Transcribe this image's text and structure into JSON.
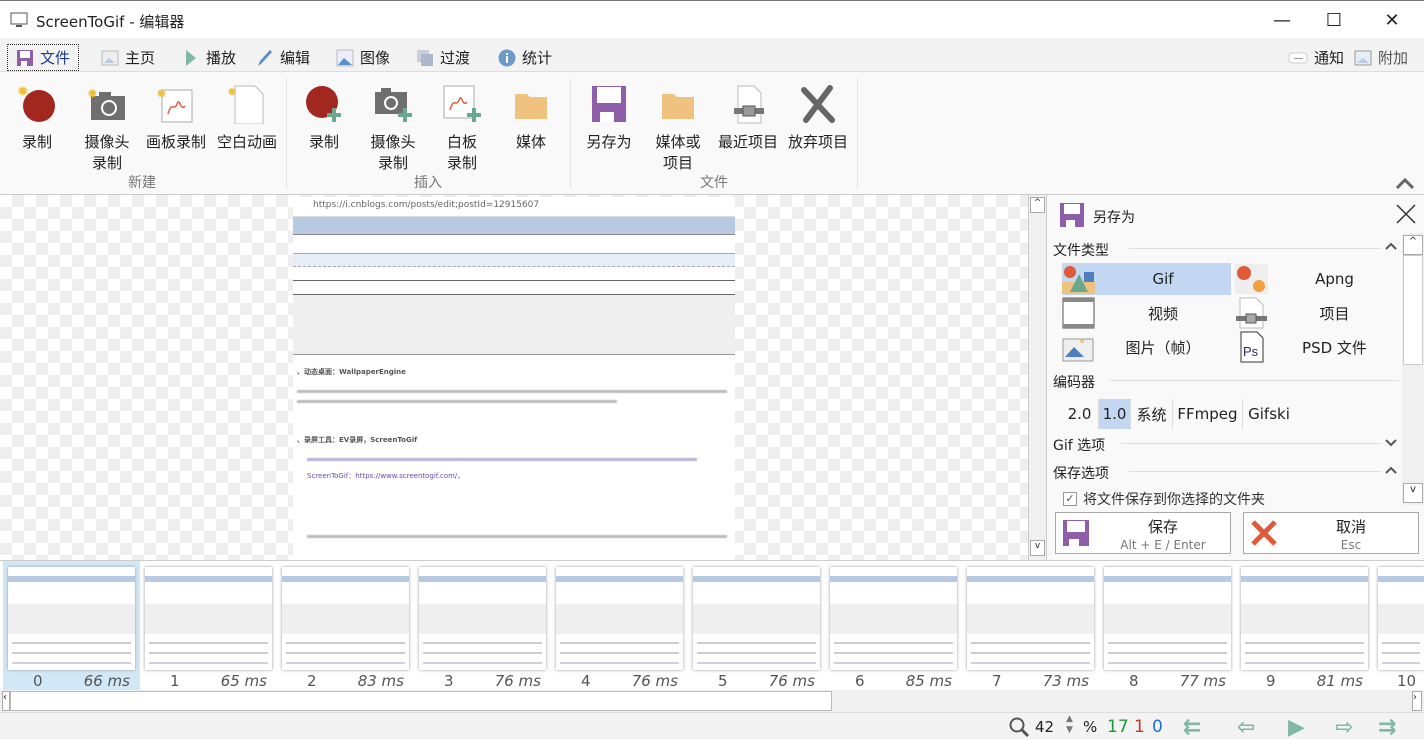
{
  "window": {
    "title": "ScreenToGif - 编辑器",
    "minimize": "—",
    "maximize": "☐",
    "close": "✕"
  },
  "tabs": [
    {
      "label": "文件",
      "icon": "floppy-icon"
    },
    {
      "label": "主页",
      "icon": "home-image-icon"
    },
    {
      "label": "播放",
      "icon": "play-icon"
    },
    {
      "label": "编辑",
      "icon": "pencil-icon"
    },
    {
      "label": "图像",
      "icon": "image-icon"
    },
    {
      "label": "过渡",
      "icon": "transition-icon"
    },
    {
      "label": "统计",
      "icon": "info-icon"
    }
  ],
  "tabs_right": {
    "notifications": "通知",
    "extras": "附加"
  },
  "ribbon": {
    "groups": [
      {
        "label": "新建"
      },
      {
        "label": "插入"
      },
      {
        "label": "文件"
      }
    ],
    "new": [
      "录制",
      "摄像头\n录制",
      "画板录制",
      "空白动画"
    ],
    "insert": [
      "录制",
      "摄像头\n录制",
      "白板\n录制",
      "媒体"
    ],
    "file": [
      "另存为",
      "媒体或\n项目",
      "最近项目",
      "放弃项目"
    ]
  },
  "canvas": {
    "url": "https://i.cnblogs.com/posts/edit;postId=12915607",
    "heading1": "、动态桌面：WallpaperEngine",
    "heading2": "、录屏工具：EV录屏，ScreenToGif",
    "text2": "ScreenToGif：https://www.screentogif.com/，"
  },
  "panel": {
    "title": "另存为",
    "file_type_label": "文件类型",
    "file_types": [
      {
        "label": "Gif",
        "selected": true
      },
      {
        "label": "Apng"
      },
      {
        "label": "视频"
      },
      {
        "label": "项目"
      },
      {
        "label": "图片（帧）"
      },
      {
        "label": "PSD 文件"
      }
    ],
    "encoder_label": "编码器",
    "encoders": [
      {
        "label": "2.0"
      },
      {
        "label": "1.0",
        "selected": true
      },
      {
        "label": "系统"
      },
      {
        "label": "FFmpeg"
      },
      {
        "label": "Gifski"
      }
    ],
    "gif_options_label": "Gif 选项",
    "save_options_label": "保存选项",
    "save_to_folder": {
      "label": "将文件保存到你选择的文件夹",
      "checked": true
    },
    "save_button": {
      "label": "保存",
      "shortcut": "Alt + E / Enter"
    },
    "cancel_button": {
      "label": "取消",
      "shortcut": "Esc"
    }
  },
  "frames": [
    {
      "n": "0",
      "ms": "66 ms"
    },
    {
      "n": "1",
      "ms": "65 ms"
    },
    {
      "n": "2",
      "ms": "83 ms"
    },
    {
      "n": "3",
      "ms": "76 ms"
    },
    {
      "n": "4",
      "ms": "76 ms"
    },
    {
      "n": "5",
      "ms": "76 ms"
    },
    {
      "n": "6",
      "ms": "85 ms"
    },
    {
      "n": "7",
      "ms": "73 ms"
    },
    {
      "n": "8",
      "ms": "77 ms"
    },
    {
      "n": "9",
      "ms": "81 ms"
    },
    {
      "n": "10",
      "ms": ""
    }
  ],
  "selected_frame": 0,
  "status": {
    "zoom": "42",
    "zoom_unit": "%",
    "total_frames": "17",
    "selected_count": "1",
    "current_index": "0"
  },
  "colors": {
    "accent": "#c3d7f2",
    "save_purple": "#8e5ea8",
    "cancel_red": "#e05a3a",
    "frames_green": "#1a9c3a",
    "selected_red": "#c0392b",
    "index_blue": "#1e6fd9",
    "nav_green": "#7fb8a4"
  }
}
